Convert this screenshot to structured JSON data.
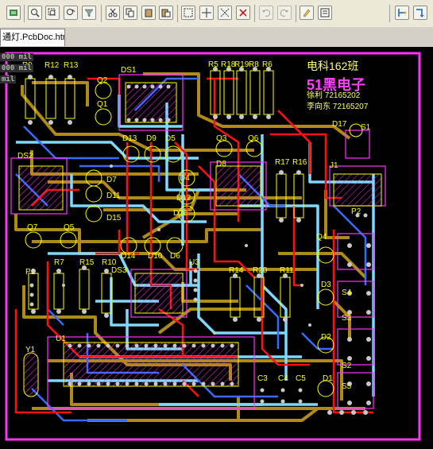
{
  "toolbar": {
    "icons": [
      "board-icon",
      "zoom-fit-icon",
      "zoom-area-icon",
      "zoom-select-icon",
      "filter-icon",
      "cut-icon",
      "copy-icon",
      "paste-icon",
      "paste-special-icon",
      "select-rect-icon",
      "move-icon",
      "deselect-icon",
      "clear-icon",
      "undo-icon",
      "redo-icon",
      "highlight-icon",
      "inspector-icon",
      "place-icon",
      "route-icon"
    ]
  },
  "tab": {
    "label": "通灯.PcbDoc.htm"
  },
  "coords": {
    "line1": "000 mil",
    "line2": "000 mil",
    "line3": "mil"
  },
  "board": {
    "title": "电科162班",
    "brand": "51黑电子",
    "id_line1": "徐利 72165202",
    "id_line2": "李向东 72165207",
    "colors": {
      "top_layer": "#ff0000",
      "bottom_layer": "#3a6bff",
      "top_overlay": "#ffff00",
      "mech": "#ff00ff",
      "keepout": "#ff33ff",
      "via": "#c0c0c0",
      "pad": "#c8c8c8",
      "track_cyan": "#7fd8ff",
      "track_ochre": "#b08a18"
    }
  },
  "designators": [
    "R9",
    "R12",
    "R13",
    "DS1",
    "Q2",
    "Q1",
    "R5",
    "R18",
    "R19",
    "R8",
    "R6",
    "D17",
    "S1",
    "D13",
    "D9",
    "D5",
    "Q3",
    "Q6",
    "R17",
    "R16",
    "J1",
    "DS2",
    "D7",
    "D11",
    "D15",
    "D4",
    "D12",
    "D16",
    "D8",
    "P2",
    "Q4",
    "Q5",
    "D14",
    "D10",
    "D6",
    "R7",
    "R15",
    "R10",
    "P1",
    "DS3",
    "U3",
    "R14",
    "R20",
    "R11",
    "D3",
    "S4",
    "S3",
    "D2",
    "S2",
    "U1",
    "Y1",
    "C3",
    "C4",
    "C5",
    "D1",
    "S5"
  ]
}
